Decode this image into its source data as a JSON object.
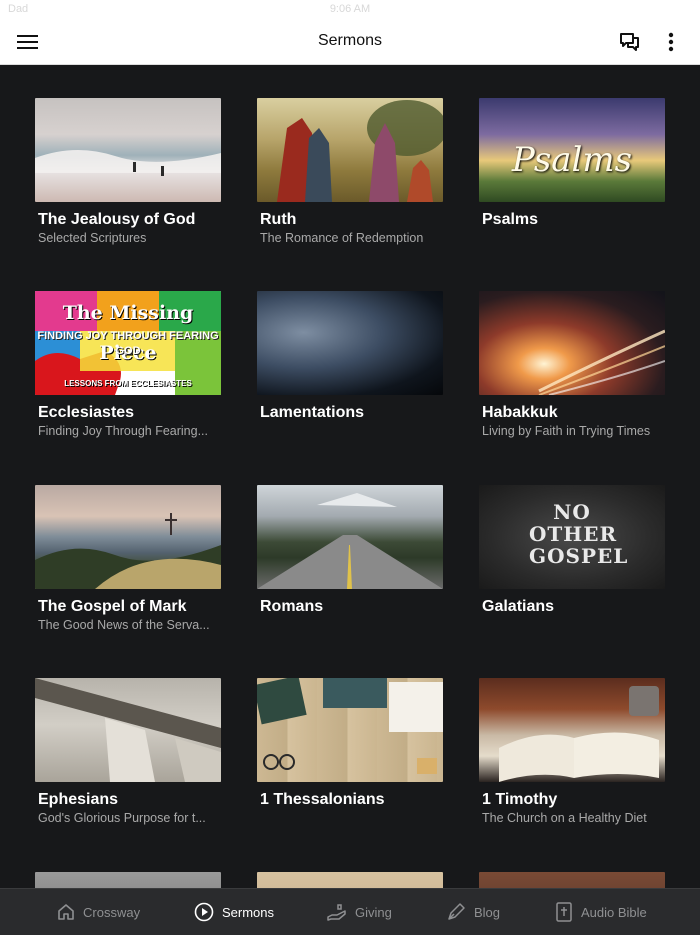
{
  "status": {
    "carrier": "Dad",
    "time": "9:06 AM"
  },
  "header": {
    "title": "Sermons"
  },
  "sermons": [
    {
      "title": "The Jealousy of God",
      "subtitle": "Selected Scriptures"
    },
    {
      "title": "Ruth",
      "subtitle": "The Romance of Redemption"
    },
    {
      "title": "Psalms",
      "subtitle": "",
      "art_text": "Psalms"
    },
    {
      "title": "Ecclesiastes",
      "subtitle": "Finding Joy Through Fearing...",
      "art_top": "The Missing Piece",
      "art_mid": "FINDING JOY THROUGH FEARING GOD",
      "art_bot": "LESSONS FROM ECCLESIASTES"
    },
    {
      "title": "Lamentations",
      "subtitle": ""
    },
    {
      "title": "Habakkuk",
      "subtitle": "Living by Faith in Trying Times"
    },
    {
      "title": "The Gospel of Mark",
      "subtitle": "The Good News of the Serva..."
    },
    {
      "title": "Romans",
      "subtitle": ""
    },
    {
      "title": "Galatians",
      "subtitle": "",
      "art_text": "NO OTHER GOSPEL"
    },
    {
      "title": "Ephesians",
      "subtitle": "God's Glorious Purpose for t..."
    },
    {
      "title": "1 Thessalonians",
      "subtitle": ""
    },
    {
      "title": "1 Timothy",
      "subtitle": "The Church on a Healthy Diet"
    }
  ],
  "tabs": [
    {
      "label": "Crossway",
      "icon": "home-icon",
      "active": false
    },
    {
      "label": "Sermons",
      "icon": "play-circle-icon",
      "active": true
    },
    {
      "label": "Giving",
      "icon": "giving-hand-icon",
      "active": false
    },
    {
      "label": "Blog",
      "icon": "pen-icon",
      "active": false
    },
    {
      "label": "Audio Bible",
      "icon": "bible-icon",
      "active": false
    }
  ]
}
